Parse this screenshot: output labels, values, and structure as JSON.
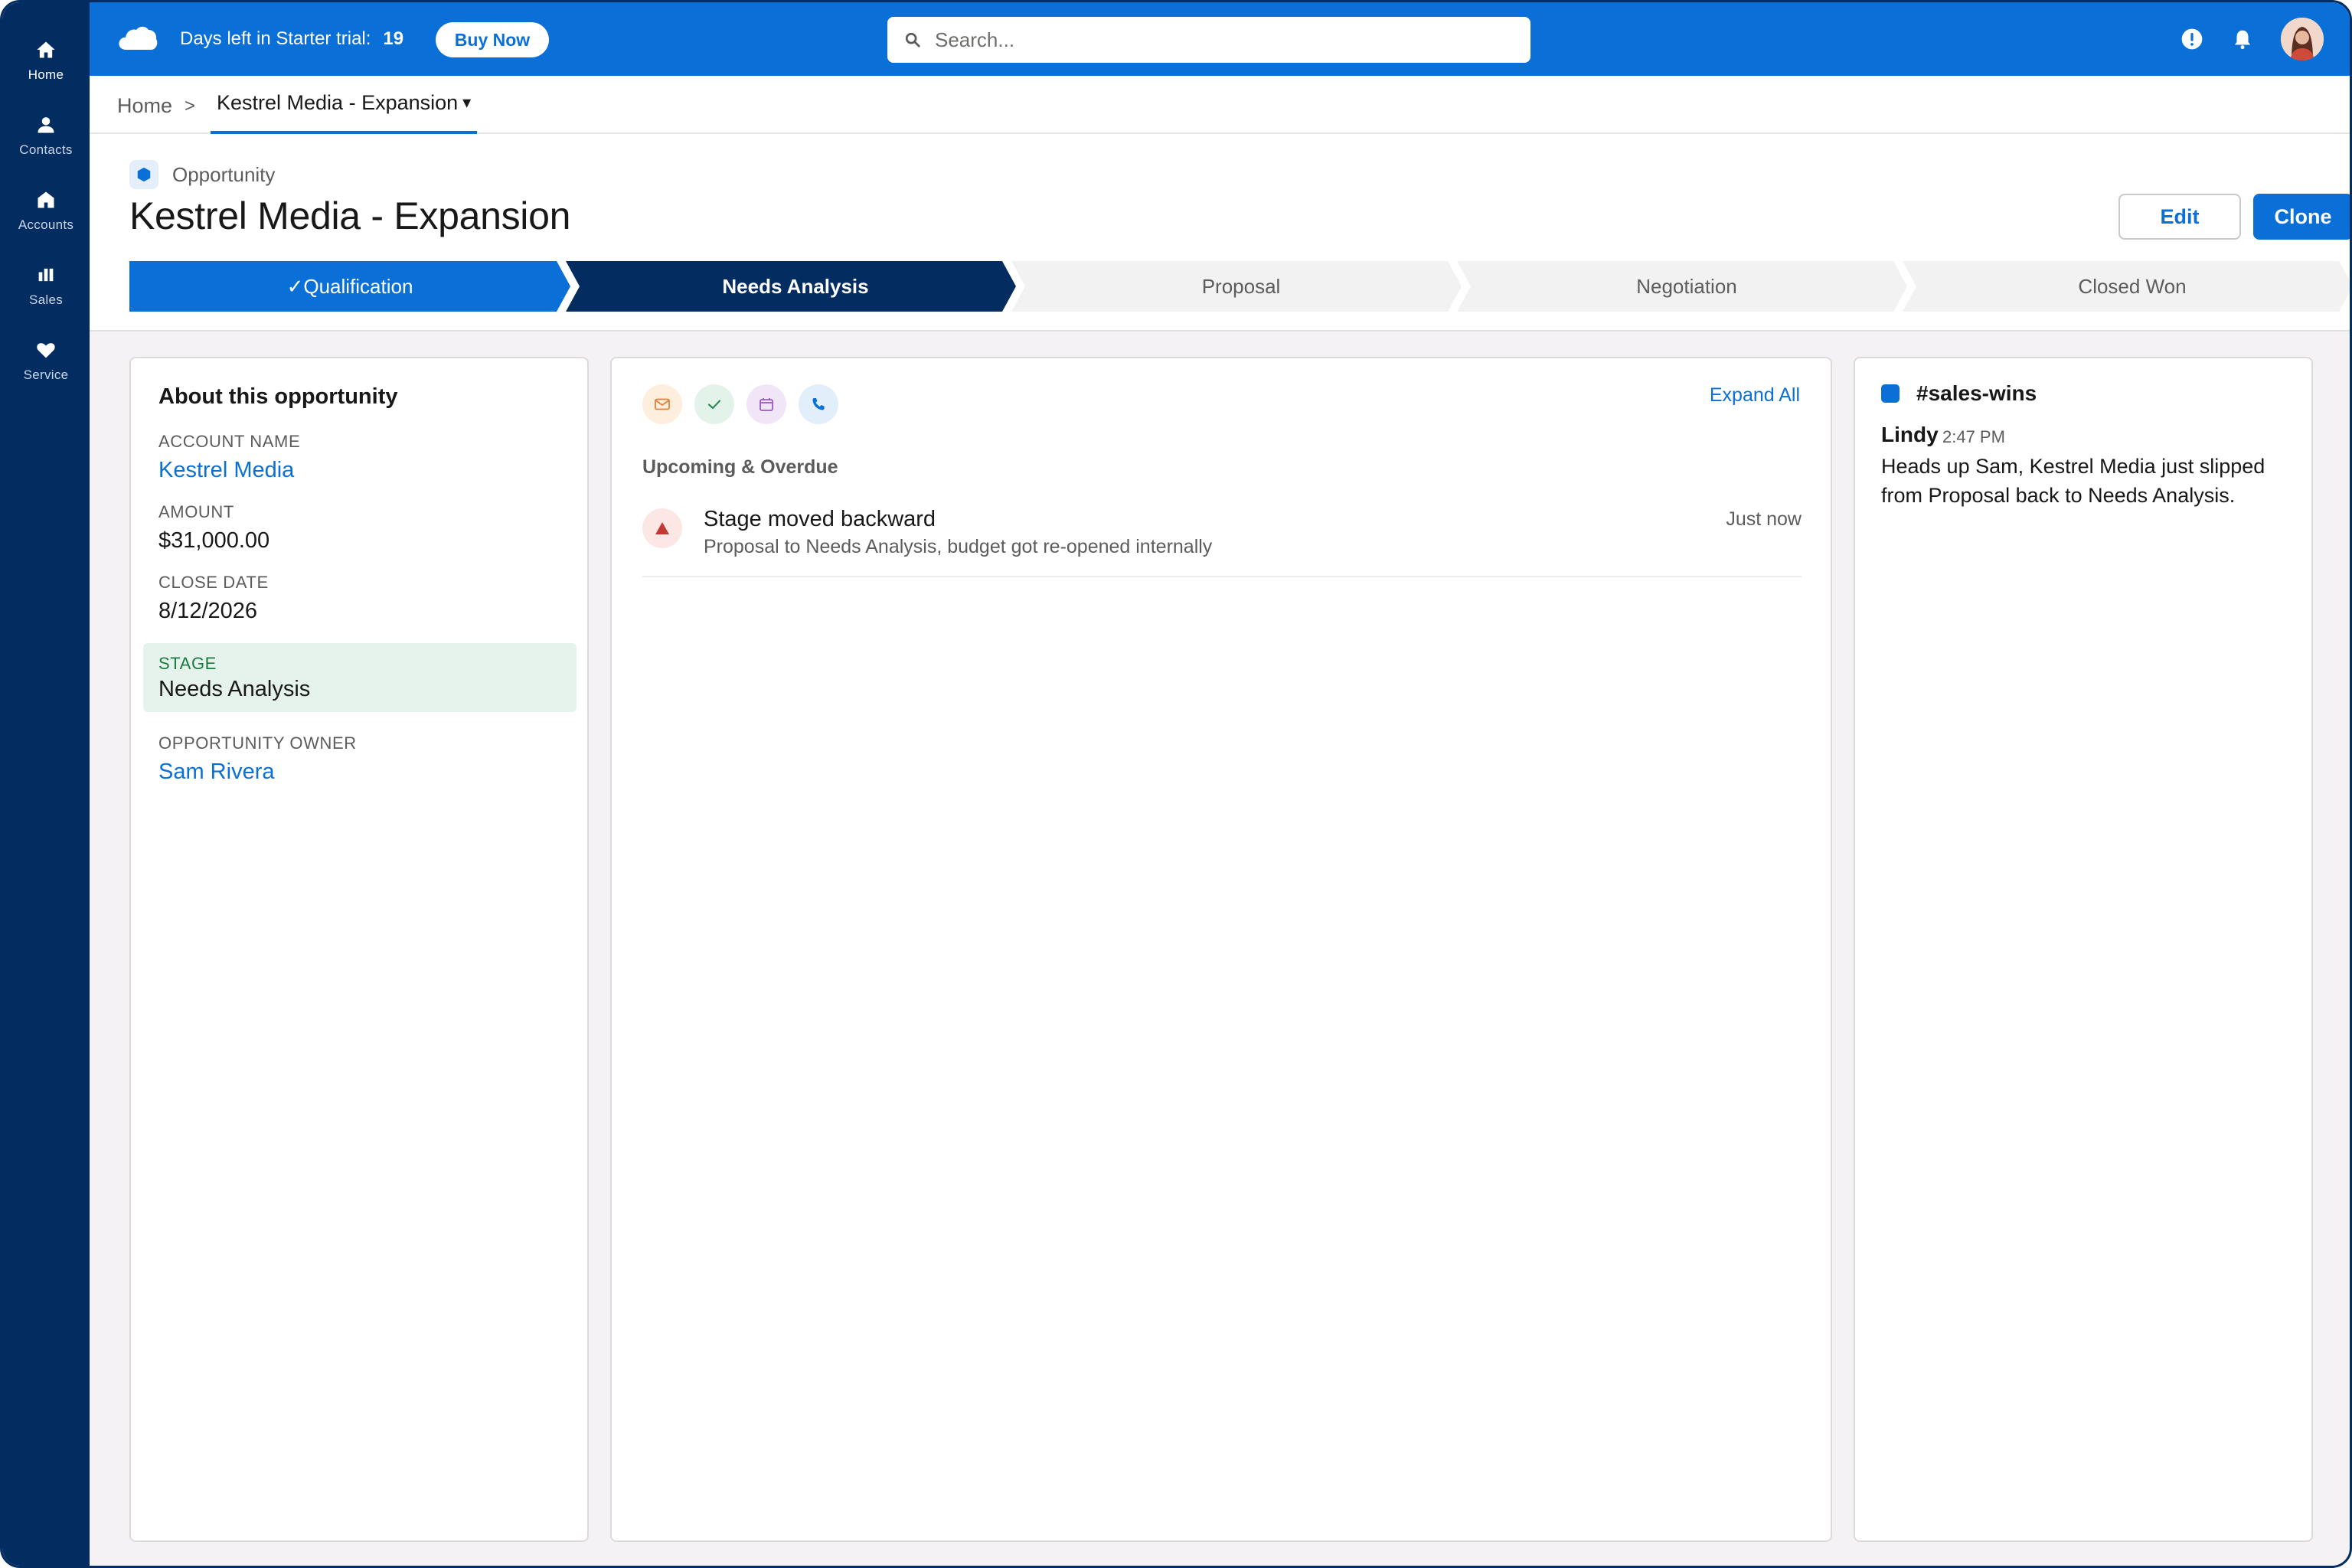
{
  "nav": {
    "items": [
      {
        "label": "Home",
        "icon": "home-icon"
      },
      {
        "label": "Contacts",
        "icon": "person-icon"
      },
      {
        "label": "Accounts",
        "icon": "building-icon"
      },
      {
        "label": "Sales",
        "icon": "bar-chart-icon"
      },
      {
        "label": "Service",
        "icon": "heart-icon"
      }
    ]
  },
  "topbar": {
    "trial_label": "Days left in Starter trial:",
    "trial_days": "19",
    "buy_label": "Buy Now",
    "search_placeholder": "Search..."
  },
  "breadcrumb": {
    "home": "Home",
    "separator": ">",
    "current": "Kestrel Media - Expansion",
    "caret": "▾"
  },
  "record": {
    "object_type": "Opportunity",
    "title": "Kestrel Media - Expansion",
    "edit_label": "Edit",
    "clone_label": "Clone",
    "path": [
      {
        "label": "✓Qualification",
        "state": "complete"
      },
      {
        "label": "Needs Analysis",
        "state": "current"
      },
      {
        "label": "Proposal",
        "state": "incomplete"
      },
      {
        "label": "Negotiation",
        "state": "incomplete"
      },
      {
        "label": "Closed Won",
        "state": "incomplete"
      }
    ]
  },
  "about": {
    "title": "About this opportunity",
    "account_label": "ACCOUNT NAME",
    "account_value": "Kestrel Media",
    "amount_label": "AMOUNT",
    "amount_value": "$31,000.00",
    "close_label": "CLOSE DATE",
    "close_value": "8/12/2026",
    "stage_label": "STAGE",
    "stage_value": "Needs Analysis",
    "owner_label": "OPPORTUNITY OWNER",
    "owner_value": "Sam Rivera"
  },
  "activity": {
    "expand_all": "Expand All",
    "section_title": "Upcoming & Overdue",
    "items": [
      {
        "title": "Stage moved backward",
        "subtitle": "Proposal to Needs Analysis, budget got re-opened internally",
        "time": "Just now"
      }
    ]
  },
  "slack": {
    "channel": "#sales-wins",
    "author": "Lindy",
    "time": "2:47 PM",
    "message": "Heads up Sam, Kestrel Media just slipped from Proposal back to Needs Analysis."
  },
  "colors": {
    "brand_blue": "#0a6fd6",
    "nav_navy": "#032d60",
    "path_complete": "#0a6fd6",
    "path_current": "#032d60",
    "path_incomplete": "#f3f2f2"
  }
}
